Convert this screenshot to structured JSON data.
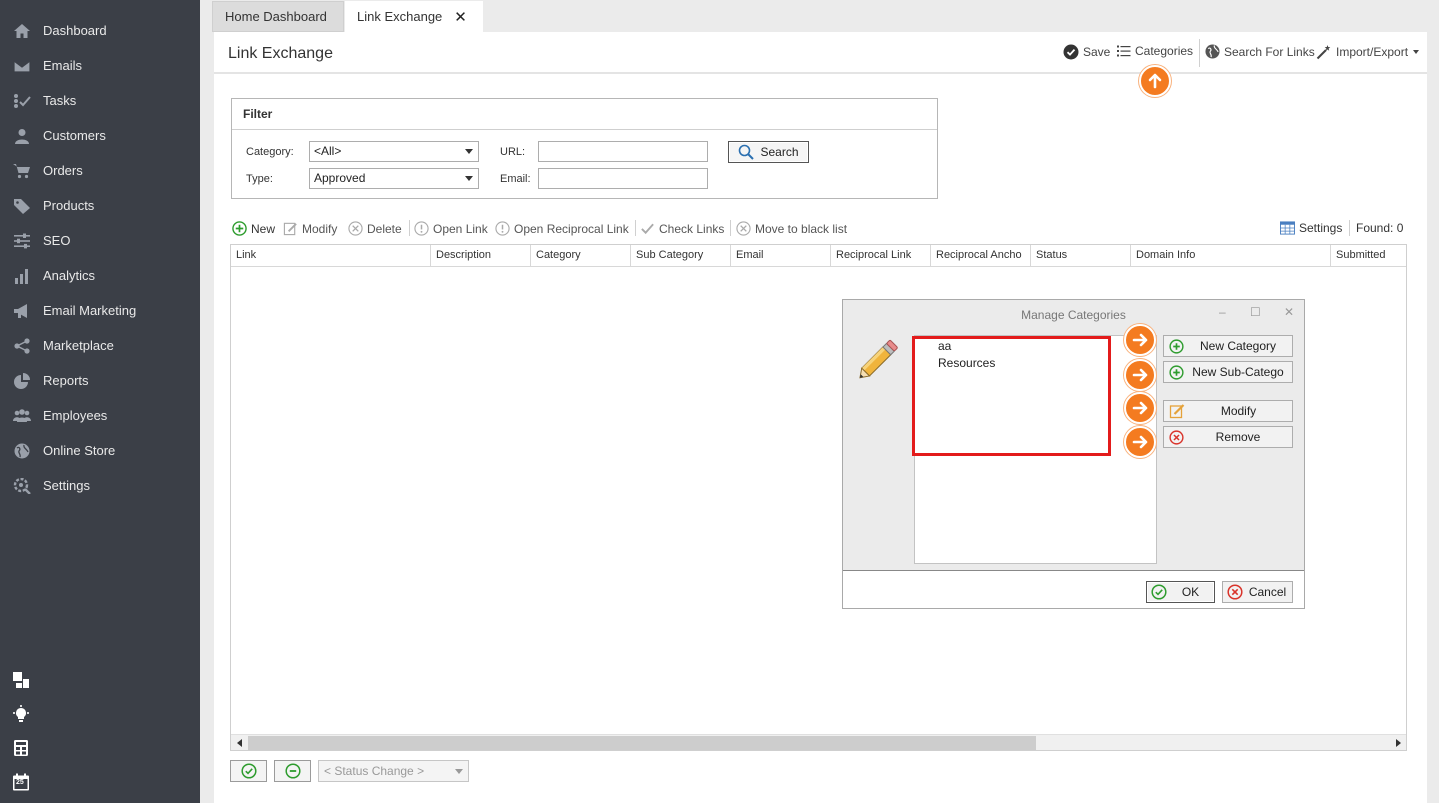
{
  "sidebar": {
    "items": [
      {
        "label": "Dashboard",
        "icon": "home-icon"
      },
      {
        "label": "Emails",
        "icon": "envelope-icon"
      },
      {
        "label": "Tasks",
        "icon": "tasks-icon"
      },
      {
        "label": "Customers",
        "icon": "user-icon"
      },
      {
        "label": "Orders",
        "icon": "cart-icon"
      },
      {
        "label": "Products",
        "icon": "tag-icon"
      },
      {
        "label": "SEO",
        "icon": "sliders-icon"
      },
      {
        "label": "Analytics",
        "icon": "bar-chart-icon"
      },
      {
        "label": "Email Marketing",
        "icon": "megaphone-icon"
      },
      {
        "label": "Marketplace",
        "icon": "share-icon"
      },
      {
        "label": "Reports",
        "icon": "pie-chart-icon"
      },
      {
        "label": "Employees",
        "icon": "users-icon"
      },
      {
        "label": "Online Store",
        "icon": "globe-icon"
      },
      {
        "label": "Settings",
        "icon": "gear-search-icon"
      }
    ],
    "bottom_icons": [
      "layout-icon",
      "lightbulb-icon",
      "calculator-icon",
      "calendar-icon"
    ],
    "calendar_day": "25"
  },
  "tabs": [
    {
      "label": "Home Dashboard",
      "active": false
    },
    {
      "label": "Link Exchange",
      "active": true,
      "close": "✕"
    }
  ],
  "page": {
    "title": "Link Exchange"
  },
  "toolbar": {
    "save": "Save",
    "categories": "Categories",
    "search_links": "Search For Links",
    "import_export": "Import/Export"
  },
  "filter": {
    "title": "Filter",
    "category_label": "Category:",
    "category_value": "<All>",
    "type_label": "Type:",
    "type_value": "Approved",
    "url_label": "URL:",
    "url_value": "",
    "email_label": "Email:",
    "email_value": "",
    "search_button": "Search"
  },
  "grid_toolbar": {
    "new": "New",
    "modify": "Modify",
    "delete": "Delete",
    "open_link": "Open Link",
    "open_reciprocal": "Open Reciprocal Link",
    "check_links": "Check Links",
    "black_list": "Move to black list",
    "settings": "Settings",
    "found": "Found: 0"
  },
  "grid": {
    "columns": [
      "Link",
      "Description",
      "Category",
      "Sub Category",
      "Email",
      "Reciprocal Link",
      "Reciprocal Ancho",
      "Status",
      "Domain Info",
      "Submitted"
    ],
    "rows": []
  },
  "footer": {
    "status_change": "< Status Change >"
  },
  "dialog": {
    "title": "Manage Categories",
    "controls": {
      "minimize": "–",
      "maximize": "☐",
      "close": "✕"
    },
    "categories": [
      "aa",
      "Resources"
    ],
    "buttons": {
      "new_category": "New Category",
      "new_subcategory": "New Sub-Catego",
      "modify": "Modify",
      "remove": "Remove"
    },
    "ok": "OK",
    "cancel": "Cancel"
  },
  "colors": {
    "sidebar_bg": "#3b3f47",
    "accent_orange": "#f47b20",
    "highlight_red": "#e31b1b",
    "add_green": "#2e9c2e",
    "remove_red": "#d9342b"
  }
}
